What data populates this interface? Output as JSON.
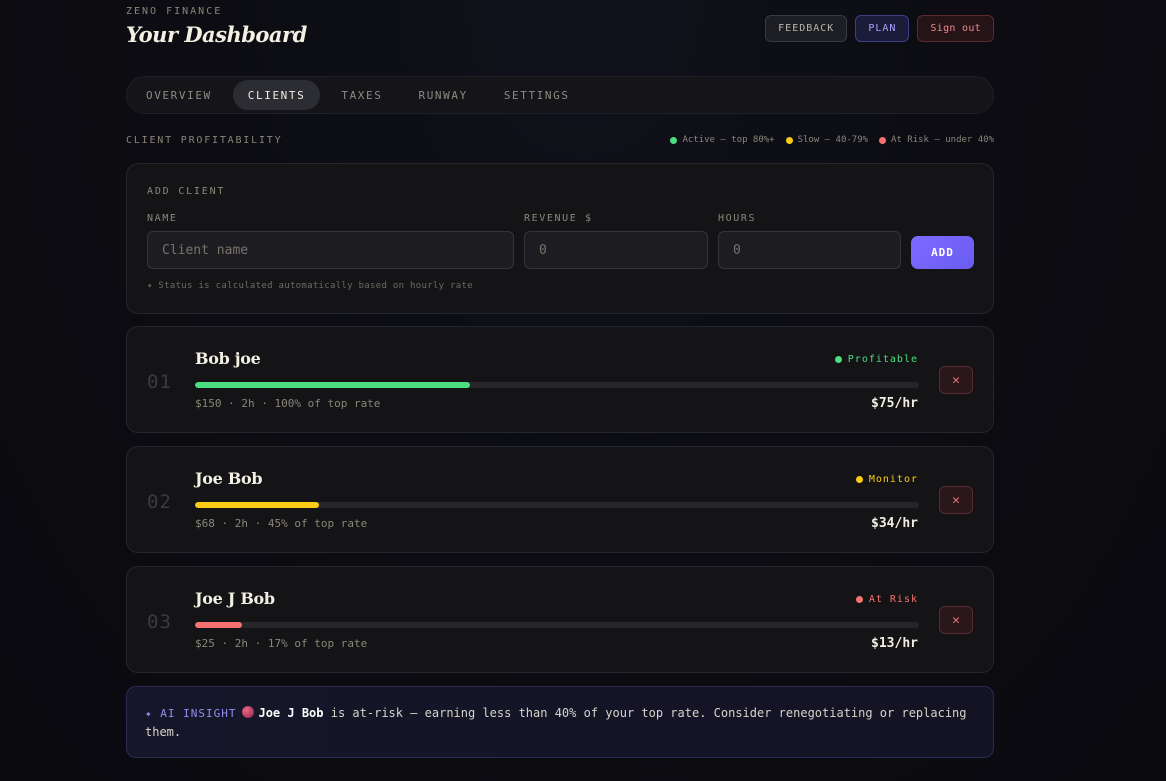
{
  "header": {
    "brand": "ZENO FINANCE",
    "title": "Your Dashboard",
    "feedback_label": "FEEDBACK",
    "plan_label": "PLAN",
    "signout_label": "Sign out"
  },
  "tabs": [
    {
      "label": "OVERVIEW",
      "active": false
    },
    {
      "label": "CLIENTS",
      "active": true
    },
    {
      "label": "TAXES",
      "active": false
    },
    {
      "label": "RUNWAY",
      "active": false
    },
    {
      "label": "SETTINGS",
      "active": false
    }
  ],
  "section": {
    "label": "CLIENT PROFITABILITY",
    "legend": [
      {
        "label": "Active — top 80%+",
        "color": "#4ade80"
      },
      {
        "label": "Slow — 40-79%",
        "color": "#facc15"
      },
      {
        "label": "At Risk — under 40%",
        "color": "#f87171"
      }
    ]
  },
  "add_client": {
    "title": "ADD CLIENT",
    "name_label": "NAME",
    "name_placeholder": "Client name",
    "revenue_label": "REVENUE $",
    "revenue_placeholder": "0",
    "hours_label": "HOURS",
    "hours_placeholder": "0",
    "add_label": "ADD",
    "hint": "✦ Status is calculated automatically based on hourly rate"
  },
  "clients": [
    {
      "num": "01",
      "name": "Bob joe",
      "status": "Profitable",
      "color": "#4ade80",
      "pct_of_top": 100,
      "meta": "$150 · 2h · 100% of top rate",
      "rate": "$75/hr",
      "delete": "✕"
    },
    {
      "num": "02",
      "name": "Joe Bob",
      "status": "Monitor",
      "color": "#facc15",
      "pct_of_top": 45,
      "meta": "$68 · 2h · 45% of top rate",
      "rate": "$34/hr",
      "delete": "✕"
    },
    {
      "num": "03",
      "name": "Joe J Bob",
      "status": "At Risk",
      "color": "#f87171",
      "pct_of_top": 17,
      "meta": "$25 · 2h · 17% of top rate",
      "rate": "$13/hr",
      "delete": "✕"
    }
  ],
  "insight": {
    "tag": "✦ AI INSIGHT",
    "name": "Joe J Bob",
    "text": " is at-risk — earning less than 40% of your top rate. Consider renegotiating or replacing them."
  }
}
